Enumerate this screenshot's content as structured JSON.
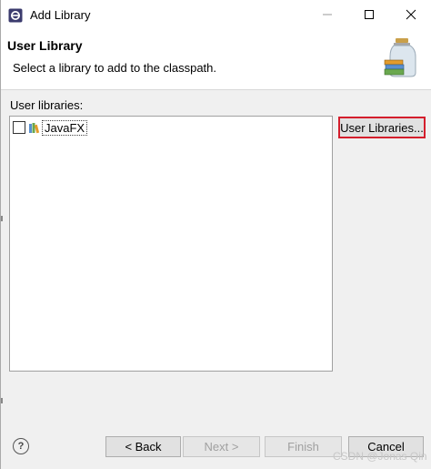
{
  "window": {
    "title": "Add Library",
    "controls": {
      "minimize": "minimize-icon",
      "maximize": "maximize-icon",
      "close": "close-icon"
    }
  },
  "banner": {
    "title": "User Library",
    "message": "Select a library to add to the classpath.",
    "icon": "library-jar-icon"
  },
  "body": {
    "list_label": "User libraries:",
    "libraries": [
      {
        "name": "JavaFX",
        "checked": false,
        "icon": "library-icon"
      }
    ],
    "user_libraries_button": "User Libraries..."
  },
  "footer": {
    "help_icon": "help-icon",
    "help_glyph": "?",
    "back": "< Back",
    "next": "Next >",
    "finish": "Finish",
    "cancel": "Cancel"
  },
  "watermark": "CSDN @Jonas Qin",
  "colors": {
    "highlight_border": "#d41e2c",
    "dialog_bg": "#f0f0f0",
    "disabled_text": "#a0a0a0"
  }
}
